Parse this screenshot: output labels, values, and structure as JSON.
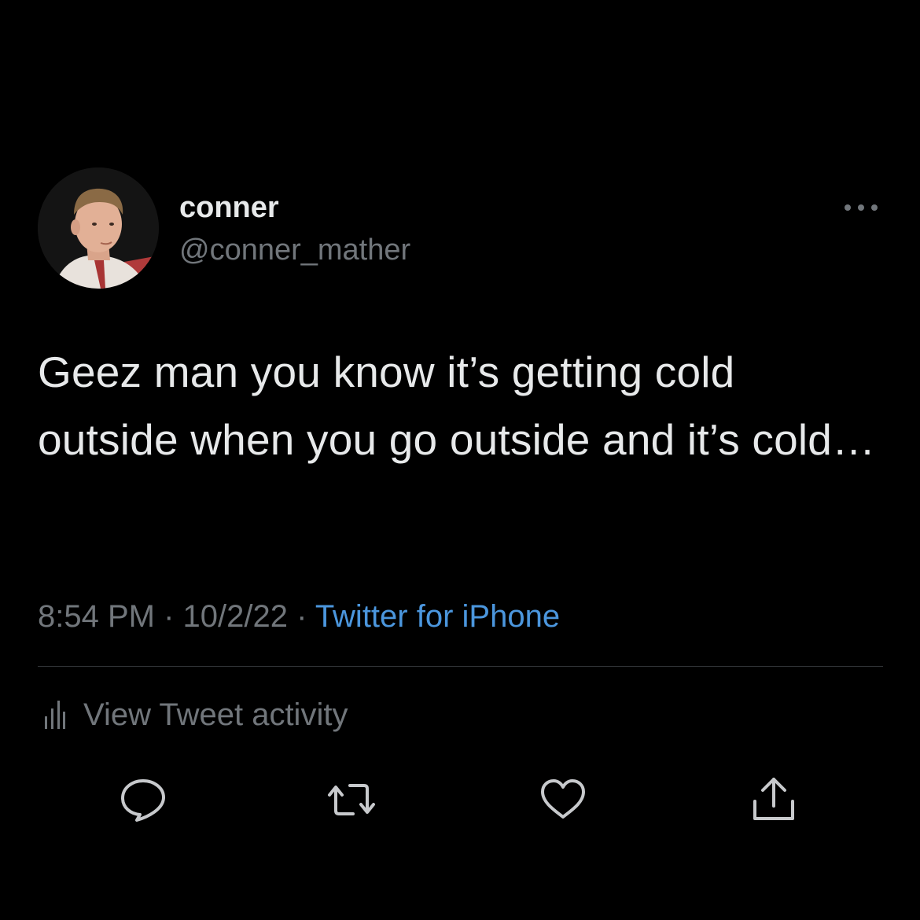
{
  "author": {
    "display_name": "conner",
    "handle": "@conner_mather",
    "avatar": "profile-photo"
  },
  "tweet": {
    "text": "Geez man you know it’s getting cold outside when you go outside and it’s cold…"
  },
  "meta": {
    "time": "8:54 PM",
    "separator": " · ",
    "date": "10/2/22",
    "source": "Twitter for iPhone"
  },
  "activity": {
    "label": "View Tweet activity",
    "icon": "bar-chart-icon"
  },
  "actions": [
    {
      "name": "reply",
      "icon": "comment-icon"
    },
    {
      "name": "retweet",
      "icon": "retweet-icon"
    },
    {
      "name": "like",
      "icon": "heart-icon"
    },
    {
      "name": "share",
      "icon": "share-icon"
    }
  ],
  "colors": {
    "background": "#000000",
    "primary_text": "#e7e9ea",
    "secondary_text": "#71767b",
    "link": "#4b96dd",
    "divider": "#2f3336"
  }
}
